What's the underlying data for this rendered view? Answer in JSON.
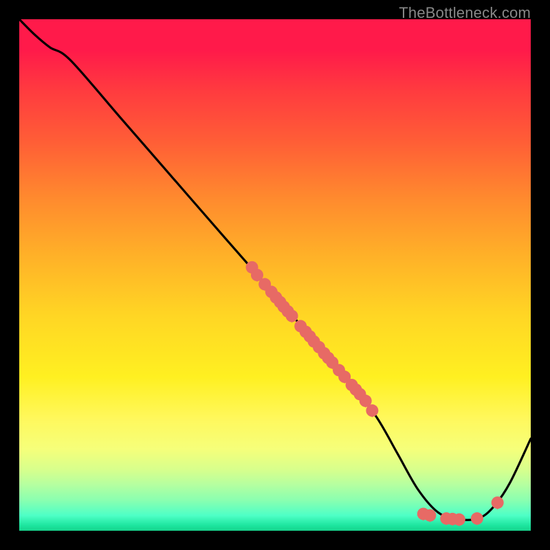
{
  "watermark": "TheBottleneck.com",
  "chart_data": {
    "type": "line",
    "title": "",
    "xlabel": "",
    "ylabel": "",
    "xlim": [
      0,
      100
    ],
    "ylim": [
      0,
      100
    ],
    "curve": {
      "name": "bottleneck-curve",
      "x": [
        0,
        3,
        6,
        10,
        20,
        30,
        40,
        45,
        50,
        55,
        60,
        65,
        70,
        74,
        78,
        82,
        86,
        90,
        93,
        96,
        100
      ],
      "y": [
        100,
        97,
        94.5,
        92,
        80.5,
        69,
        57.5,
        51.8,
        46,
        40.2,
        34.5,
        28.7,
        22,
        15,
        8,
        3.5,
        2.2,
        2.5,
        5,
        9.5,
        18
      ]
    },
    "scatter": {
      "name": "data-points",
      "color": "#e76a65",
      "points": [
        {
          "x": 45.5,
          "y": 51.5
        },
        {
          "x": 46.5,
          "y": 50.0
        },
        {
          "x": 48.0,
          "y": 48.2
        },
        {
          "x": 49.3,
          "y": 46.7
        },
        {
          "x": 50.2,
          "y": 45.6
        },
        {
          "x": 51.0,
          "y": 44.7
        },
        {
          "x": 51.7,
          "y": 43.8
        },
        {
          "x": 52.5,
          "y": 42.9
        },
        {
          "x": 53.3,
          "y": 42.0
        },
        {
          "x": 55.0,
          "y": 40.0
        },
        {
          "x": 56.0,
          "y": 38.9
        },
        {
          "x": 56.8,
          "y": 38.0
        },
        {
          "x": 57.6,
          "y": 37.0
        },
        {
          "x": 58.6,
          "y": 35.9
        },
        {
          "x": 59.6,
          "y": 34.7
        },
        {
          "x": 60.4,
          "y": 33.8
        },
        {
          "x": 61.2,
          "y": 32.9
        },
        {
          "x": 62.5,
          "y": 31.4
        },
        {
          "x": 63.6,
          "y": 30.1
        },
        {
          "x": 65.0,
          "y": 28.5
        },
        {
          "x": 65.8,
          "y": 27.6
        },
        {
          "x": 66.6,
          "y": 26.7
        },
        {
          "x": 67.7,
          "y": 25.4
        },
        {
          "x": 69.0,
          "y": 23.5
        },
        {
          "x": 79.0,
          "y": 3.3
        },
        {
          "x": 80.3,
          "y": 3.0
        },
        {
          "x": 83.5,
          "y": 2.4
        },
        {
          "x": 84.7,
          "y": 2.3
        },
        {
          "x": 86.0,
          "y": 2.2
        },
        {
          "x": 89.5,
          "y": 2.4
        },
        {
          "x": 93.5,
          "y": 5.5
        }
      ]
    }
  }
}
